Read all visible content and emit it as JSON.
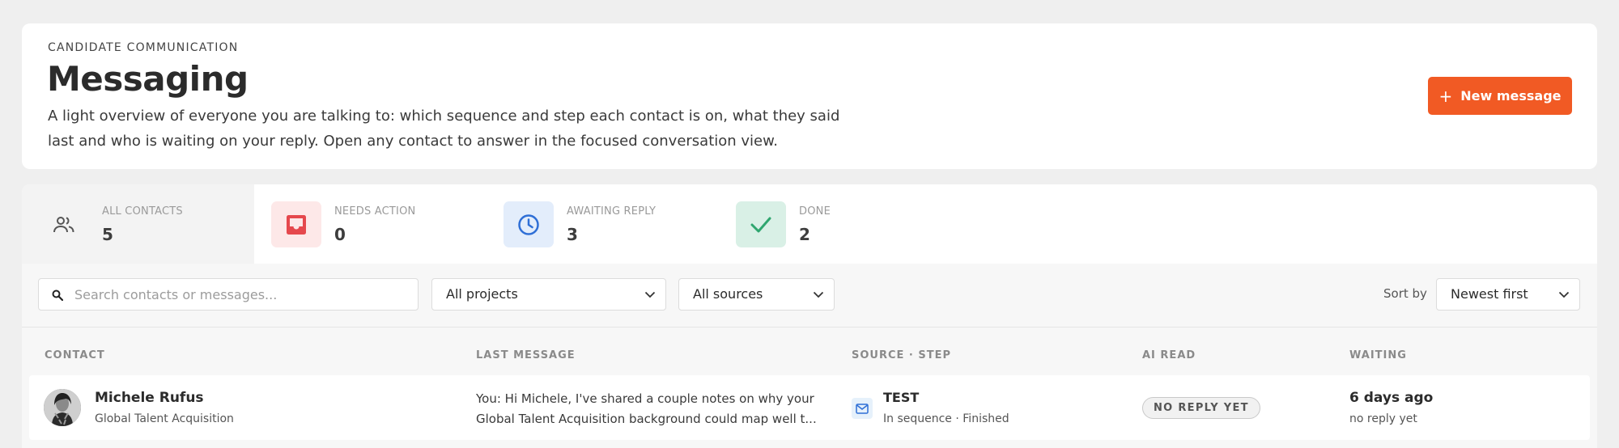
{
  "header": {
    "eyebrow": "CANDIDATE COMMUNICATION",
    "title": "Messaging",
    "description": "A light overview of everyone you are talking to: which sequence and step each contact is on, what they said last and who is waiting on your reply. Open any contact to answer in the focused conversation view.",
    "new_message_label": "New message",
    "accent_color": "#f15a24"
  },
  "tabs": [
    {
      "label": "ALL CONTACTS",
      "count": "5",
      "icon": "people-icon",
      "active": true
    },
    {
      "label": "NEEDS ACTION",
      "count": "0",
      "icon": "inbox-icon",
      "color": "#e5484d"
    },
    {
      "label": "AWAITING REPLY",
      "count": "3",
      "icon": "clock-icon",
      "color": "#2f6fd6"
    },
    {
      "label": "DONE",
      "count": "2",
      "icon": "check-icon",
      "color": "#2fa66f"
    }
  ],
  "filters": {
    "search_placeholder": "Search contacts or messages...",
    "project": "All projects",
    "source": "All sources",
    "sort_label": "Sort by",
    "sort_value": "Newest first"
  },
  "table": {
    "columns": [
      "CONTACT",
      "LAST MESSAGE",
      "SOURCE · STEP",
      "AI READ",
      "WAITING"
    ],
    "rows": [
      {
        "name": "Michele Rufus",
        "subtitle": "Global Talent Acquisition",
        "message_line1": "You: Hi Michele, I've shared a couple notes on why your",
        "message_line2": "Global Talent Acquisition background could map well t...",
        "source": "TEST",
        "step": "In sequence · Finished",
        "ai_read": "NO REPLY YET",
        "waiting": "6 days ago",
        "waiting_sub": "no reply yet"
      }
    ]
  }
}
